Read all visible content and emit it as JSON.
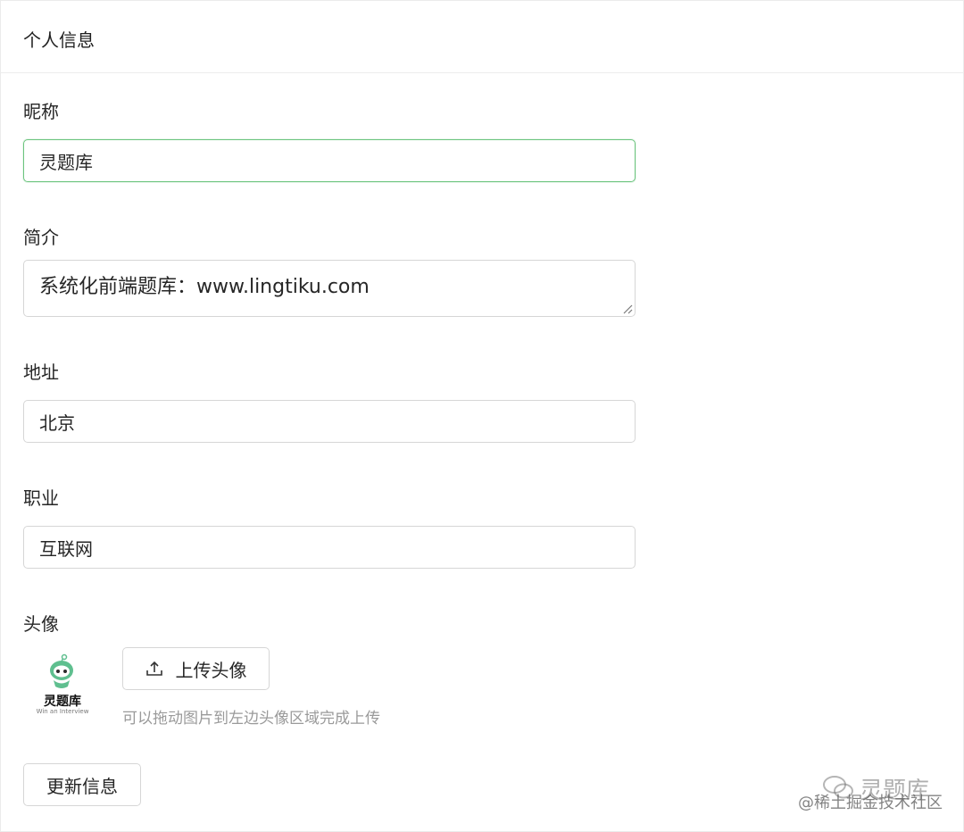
{
  "card": {
    "title": "个人信息"
  },
  "form": {
    "nickname": {
      "label": "昵称",
      "value": "灵题库"
    },
    "bio": {
      "label": "简介",
      "value": "系统化前端题库：www.lingtiku.com"
    },
    "address": {
      "label": "地址",
      "value": "北京"
    },
    "job": {
      "label": "职业",
      "value": "互联网"
    },
    "avatar": {
      "label": "头像",
      "logo_text": "灵题库",
      "logo_subtext": "Win an Interview",
      "upload_label": "上传头像",
      "upload_icon": "upload-icon",
      "hint": "可以拖动图片到左边头像区域完成上传"
    },
    "submit_label": "更新信息"
  },
  "watermark": {
    "brand": "灵题库",
    "credit": "@稀土掘金技术社区"
  },
  "colors": {
    "focus_border": "#6cc47e",
    "hint_text": "#9a9a9a",
    "border": "#d6d6d6",
    "avatar_green": "#5fbf8f"
  }
}
